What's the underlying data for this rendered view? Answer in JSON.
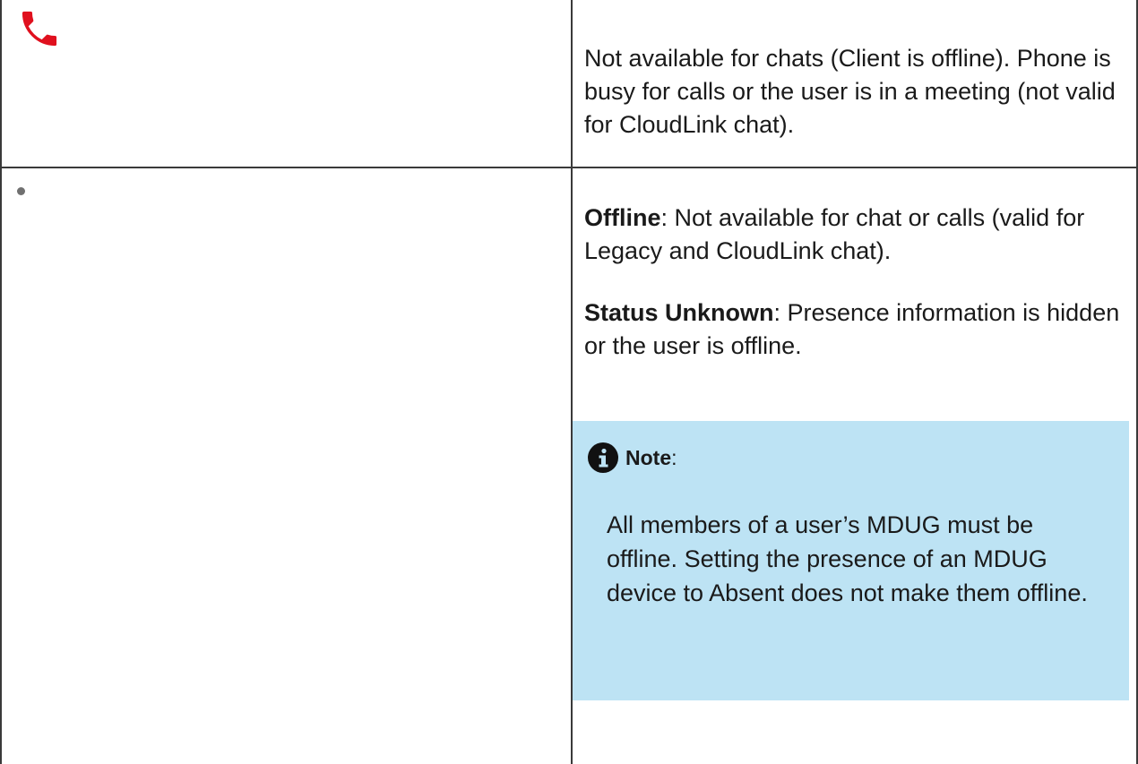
{
  "rows": [
    {
      "icon": "red-phone-icon",
      "description": "Not available for chats (Client is offline). Phone is busy for calls or the user is in a meeting (not valid for CloudLink chat)."
    },
    {
      "icon": "grey-dot-icon",
      "offline_label": "Offline",
      "offline_text": ": Not available for chat or calls (valid for Legacy and CloudLink chat).",
      "unknown_label": "Status Unknown",
      "unknown_text": ": Presence information is hidden or the user is offline.",
      "note": {
        "icon": "info-icon",
        "label": "Note",
        "suffix": ":",
        "body": "All members of a user’s MDUG must be offline. Setting the presence of an MDUG device to Absent does not make them offline."
      }
    }
  ],
  "colors": {
    "phone": "#e0101e",
    "dot": "#707070",
    "note_background": "#bde3f4",
    "border": "#3a3a3a"
  }
}
